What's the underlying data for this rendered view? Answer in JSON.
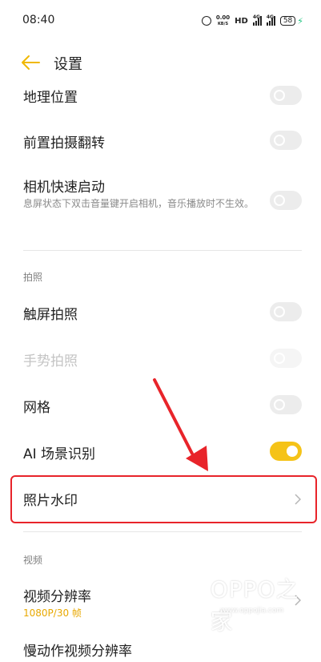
{
  "status_bar": {
    "time": "08:40",
    "net_speed_value": "0.00",
    "net_speed_unit": "KB/S",
    "hd_label": "HD",
    "signal_1_type": "4G",
    "signal_2_type": "4G",
    "battery_level": "58"
  },
  "header": {
    "title": "设置"
  },
  "rows": {
    "location": {
      "title": "地理位置",
      "enabled": false
    },
    "front_mirror": {
      "title": "前置拍摄翻转",
      "enabled": false
    },
    "quick_launch": {
      "title": "相机快速启动",
      "desc": "息屏状态下双击音量键开启相机，音乐播放时不生效。",
      "enabled": false
    },
    "touch_shoot": {
      "title": "触屏拍照",
      "enabled": false
    },
    "gesture_shoot": {
      "title": "手势拍照",
      "enabled": false,
      "disabled": true
    },
    "grid": {
      "title": "网格",
      "enabled": false
    },
    "ai_scene": {
      "title": "AI 场景识别",
      "enabled": true
    },
    "watermark": {
      "title": "照片水印"
    },
    "video_resolution": {
      "title": "视频分辨率",
      "value": "1080P/30 帧"
    },
    "slowmo_resolution": {
      "title": "慢动作视频分辨率"
    }
  },
  "sections": {
    "photo": "拍照",
    "video": "视频"
  },
  "watermark_overlay": {
    "brand": "OPPO之家",
    "url": "www.oppojia.com"
  },
  "colors": {
    "accent": "#f5c318",
    "highlight": "#e8242a",
    "value_text": "#e8a800"
  }
}
